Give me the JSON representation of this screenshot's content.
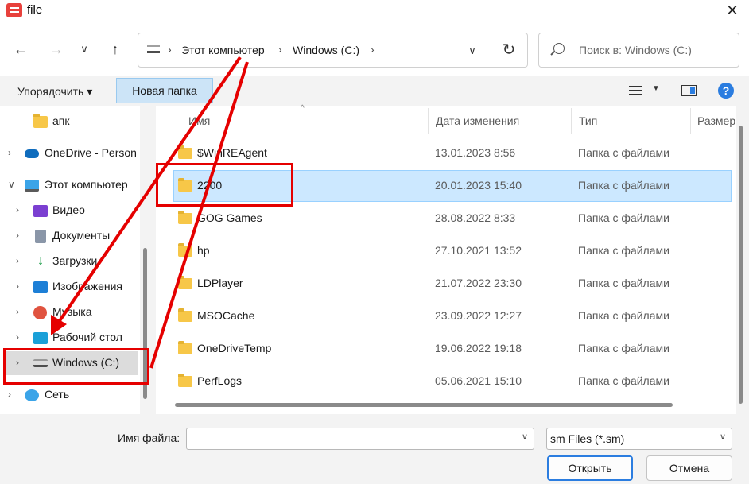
{
  "window": {
    "title": "file",
    "close_glyph": "✕"
  },
  "nav": {
    "back": "←",
    "forward": "→",
    "recent": "∨",
    "up": "↑",
    "breadcrumb": [
      "Этот компьютер",
      "Windows (C:)"
    ],
    "sep": "›",
    "address_dropdown": "∨",
    "refresh": "↻",
    "search_placeholder": "Поиск в: Windows (C:)"
  },
  "toolbar": {
    "organize": "Упорядочить ▾",
    "new_folder": "Новая папка",
    "help": "?"
  },
  "tree": [
    {
      "label": "апк",
      "icon": "folder-icon",
      "chevron": ""
    },
    {
      "label": "OneDrive - Person",
      "icon": "onedrive-icon",
      "chevron": "›"
    },
    {
      "label": "Этот компьютер",
      "icon": "computer-icon",
      "chevron": "∨"
    },
    {
      "label": "Видео",
      "icon": "video-icon",
      "chevron": "›"
    },
    {
      "label": "Документы",
      "icon": "documents-icon",
      "chevron": "›"
    },
    {
      "label": "Загрузки",
      "icon": "downloads-icon",
      "chevron": "›"
    },
    {
      "label": "Изображения",
      "icon": "images-icon",
      "chevron": "›"
    },
    {
      "label": "Музыка",
      "icon": "music-icon",
      "chevron": "›"
    },
    {
      "label": "Рабочий стол",
      "icon": "desktop-icon",
      "chevron": "›"
    },
    {
      "label": "Windows (C:)",
      "icon": "drive-icon",
      "chevron": "›"
    },
    {
      "label": "Сеть",
      "icon": "network-icon",
      "chevron": "›"
    }
  ],
  "columns": {
    "name": "Имя",
    "date": "Дата изменения",
    "type": "Тип",
    "size": "Размер"
  },
  "files": [
    {
      "name": "$WinREAgent",
      "date": "13.01.2023 8:56",
      "type": "Папка с файлами"
    },
    {
      "name": "2200",
      "date": "20.01.2023 15:40",
      "type": "Папка с файлами"
    },
    {
      "name": "GOG Games",
      "date": "28.08.2022 8:33",
      "type": "Папка с файлами"
    },
    {
      "name": "hp",
      "date": "27.10.2021 13:52",
      "type": "Папка с файлами"
    },
    {
      "name": "LDPlayer",
      "date": "21.07.2022 23:30",
      "type": "Папка с файлами"
    },
    {
      "name": "MSOCache",
      "date": "23.09.2022 12:27",
      "type": "Папка с файлами"
    },
    {
      "name": "OneDriveTemp",
      "date": "19.06.2022 19:18",
      "type": "Папка с файлами"
    },
    {
      "name": "PerfLogs",
      "date": "05.06.2021 15:10",
      "type": "Папка с файлами"
    }
  ],
  "bottom": {
    "filename_label": "Имя файла:",
    "filename_value": "",
    "filetype": "sm Files (*.sm)",
    "open": "Открыть",
    "cancel": "Отмена"
  },
  "colors": {
    "annotation_red": "#e50000",
    "selection": "#cce8ff",
    "accent": "#2b7de0"
  }
}
